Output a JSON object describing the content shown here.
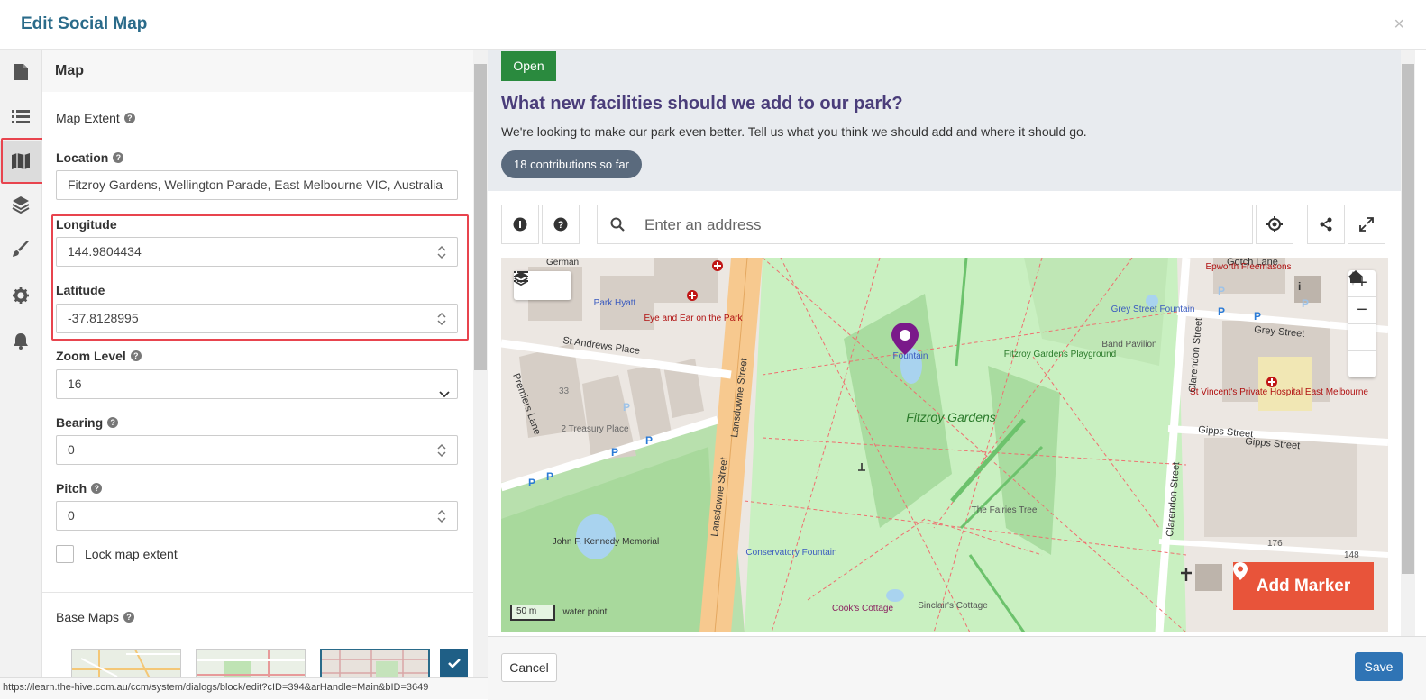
{
  "dialog": {
    "title": "Edit Social Map",
    "close_label": "×"
  },
  "rail": {
    "items": [
      "file-icon",
      "list-icon",
      "map-icon",
      "layers-icon",
      "brush-icon",
      "gear-icon",
      "bell-icon"
    ],
    "active_index": 2
  },
  "panel": {
    "section_title": "Map",
    "map_extent_label": "Map Extent",
    "location_label": "Location",
    "location_value": "Fitzroy Gardens, Wellington Parade, East Melbourne VIC, Australia",
    "longitude_label": "Longitude",
    "longitude_value": "144.9804434",
    "latitude_label": "Latitude",
    "latitude_value": "-37.8128995",
    "zoom_label": "Zoom Level",
    "zoom_value": "16",
    "bearing_label": "Bearing",
    "bearing_value": "0",
    "pitch_label": "Pitch",
    "pitch_value": "0",
    "lock_label": "Lock map extent",
    "base_maps_label": "Base Maps"
  },
  "status_url": "https://learn.the-hive.com.au/ccm/system/dialogs/block/edit?cID=394&arHandle=Main&bID=3649",
  "preview": {
    "status_badge": "Open",
    "question": "What new facilities should we add to our park?",
    "description": "We're looking to make our park even better. Tell us what you think we should add and where it should go.",
    "contributions": "18 contributions so far",
    "search_placeholder": "Enter an address",
    "add_marker_label": "Add Marker",
    "scale_label": "50 m",
    "zoom_in": "+",
    "zoom_out": "−"
  },
  "map_labels": {
    "park": "Fitzroy Gardens",
    "park_hyatt": "Park Hyatt",
    "eye_ear": "Eye and Ear on the Park",
    "st_andrews": "St Andrews Place",
    "lansdowne": "Lansdowne Street",
    "treasury": "2 Treasury Place",
    "premiers": "Premiers Lane",
    "grey_street": "Grey Street",
    "gipps_street": "Gipps Street",
    "clarendon": "Clarendon Street",
    "st_vincents": "St Vincent's Private Hospital East Melbourne",
    "playground": "Fitzroy Gardens Playground",
    "band_pavilion": "Band Pavilion",
    "fairies_tree": "The Fairies Tree",
    "conservatory": "Conservatory Fountain",
    "kennedy": "John F. Kennedy Memorial",
    "cooks": "Cook's Cottage",
    "sinclairs": "Sinclair's Cottage",
    "water_point": "water point",
    "epworth": "Epworth Freemasons",
    "gotch": "Gotch Lane",
    "german": "German",
    "grey_fountain": "Grey Street Fountain",
    "fountain": "Fountain",
    "n33": "33",
    "n176": "176",
    "n148": "148"
  },
  "footer": {
    "cancel_label": "Cancel",
    "save_label": "Save"
  },
  "colors": {
    "accent": "#2a6b8a",
    "open": "#2a8a3e",
    "marker": "#e8543a",
    "save": "#2f74b5",
    "highlight": "#e8444e"
  }
}
